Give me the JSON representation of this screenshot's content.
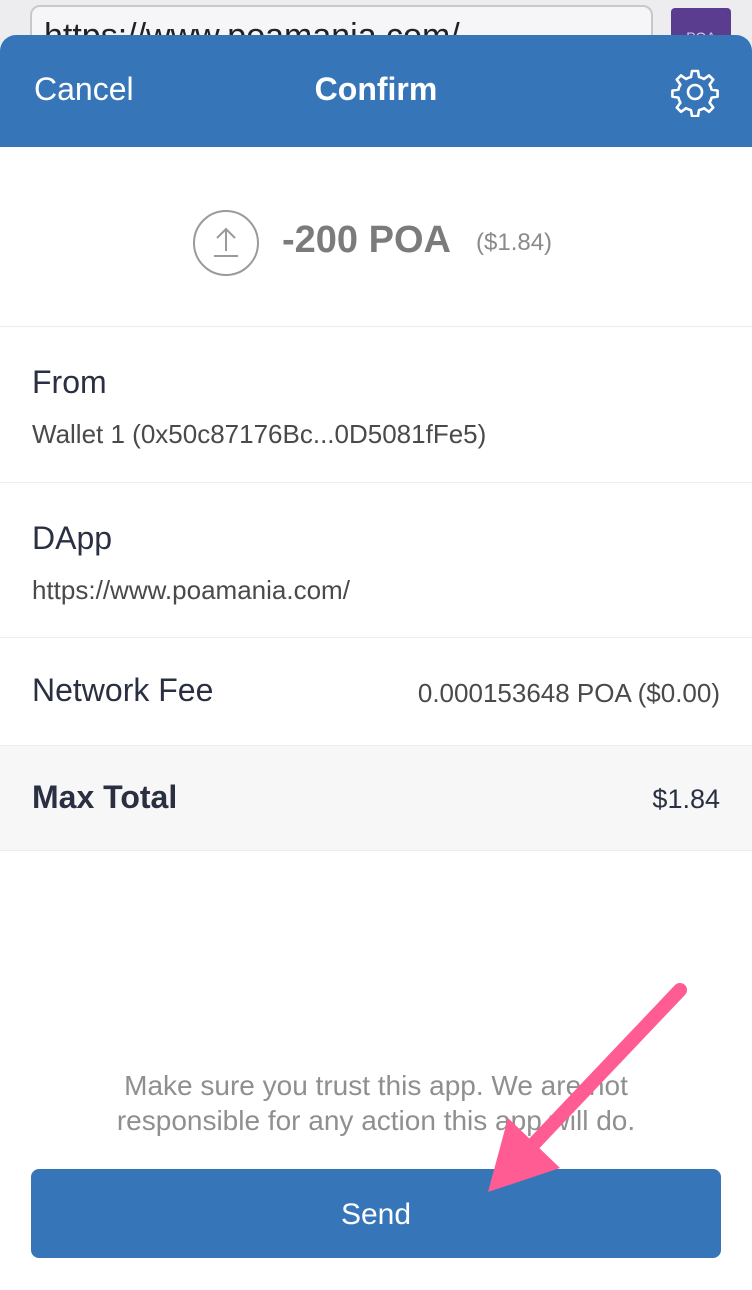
{
  "browser": {
    "url": "https://www.poamania.com/",
    "app_icon_text": "POA"
  },
  "header": {
    "cancel_label": "Cancel",
    "title": "Confirm",
    "settings_icon": "gear-icon"
  },
  "transaction": {
    "icon": "upload-icon",
    "amount": "-200 POA",
    "fiat": "($1.84)"
  },
  "from": {
    "label": "From",
    "value": "Wallet 1 (0x50c87176Bc...0D5081fFe5)"
  },
  "dapp": {
    "label": "DApp",
    "value": "https://www.poamania.com/"
  },
  "network_fee": {
    "label": "Network Fee",
    "value": "0.000153648 POA ($0.00)"
  },
  "max_total": {
    "label": "Max Total",
    "value": "$1.84"
  },
  "disclaimer": "Make sure you trust this app. We are not responsible for any action this app will do.",
  "send_label": "Send",
  "colors": {
    "header": "#3775b9",
    "send_button": "#3775b9",
    "annotation_arrow": "#ff5c93"
  }
}
